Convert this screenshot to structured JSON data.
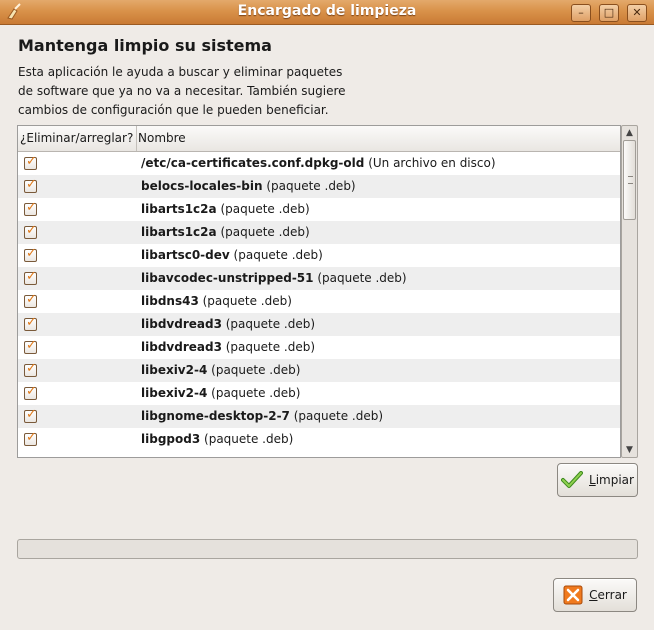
{
  "window": {
    "title": "Encargado de limpieza"
  },
  "header": {
    "heading": "Mantenga limpio su sistema",
    "description": "Esta aplicación le ayuda a buscar y eliminar paquetes\nde software que ya no va a necesitar. También sugiere\ncambios de configuración que le pueden beneficiar."
  },
  "list": {
    "columns": [
      "¿Eliminar/arreglar?",
      "Nombre"
    ],
    "rows": [
      {
        "checked": true,
        "name": "/etc/ca-certificates.conf.dpkg-old",
        "type": "(Un archivo en disco)"
      },
      {
        "checked": true,
        "name": "belocs-locales-bin",
        "type": "(paquete .deb)"
      },
      {
        "checked": true,
        "name": "libarts1c2a",
        "type": "(paquete .deb)"
      },
      {
        "checked": true,
        "name": "libarts1c2a",
        "type": "(paquete .deb)"
      },
      {
        "checked": true,
        "name": "libartsc0-dev",
        "type": "(paquete .deb)"
      },
      {
        "checked": true,
        "name": "libavcodec-unstripped-51",
        "type": "(paquete .deb)"
      },
      {
        "checked": true,
        "name": "libdns43",
        "type": "(paquete .deb)"
      },
      {
        "checked": true,
        "name": "libdvdread3",
        "type": "(paquete .deb)"
      },
      {
        "checked": true,
        "name": "libdvdread3",
        "type": "(paquete .deb)"
      },
      {
        "checked": true,
        "name": "libexiv2-4",
        "type": "(paquete .deb)"
      },
      {
        "checked": true,
        "name": "libexiv2-4",
        "type": "(paquete .deb)"
      },
      {
        "checked": true,
        "name": "libgnome-desktop-2-7",
        "type": "(paquete .deb)"
      },
      {
        "checked": true,
        "name": "libgpod3",
        "type": "(paquete .deb)"
      }
    ]
  },
  "buttons": {
    "clean": {
      "mnemonic": "L",
      "rest": "impiar",
      "icon": "checkmark-icon"
    },
    "close": {
      "mnemonic": "C",
      "rest": "errar",
      "icon": "close-icon"
    }
  },
  "progress": {
    "value": 0
  },
  "colors": {
    "titlebar": "#d9924a",
    "check": "#e07a1a",
    "row_alt": "#eeeeee"
  }
}
